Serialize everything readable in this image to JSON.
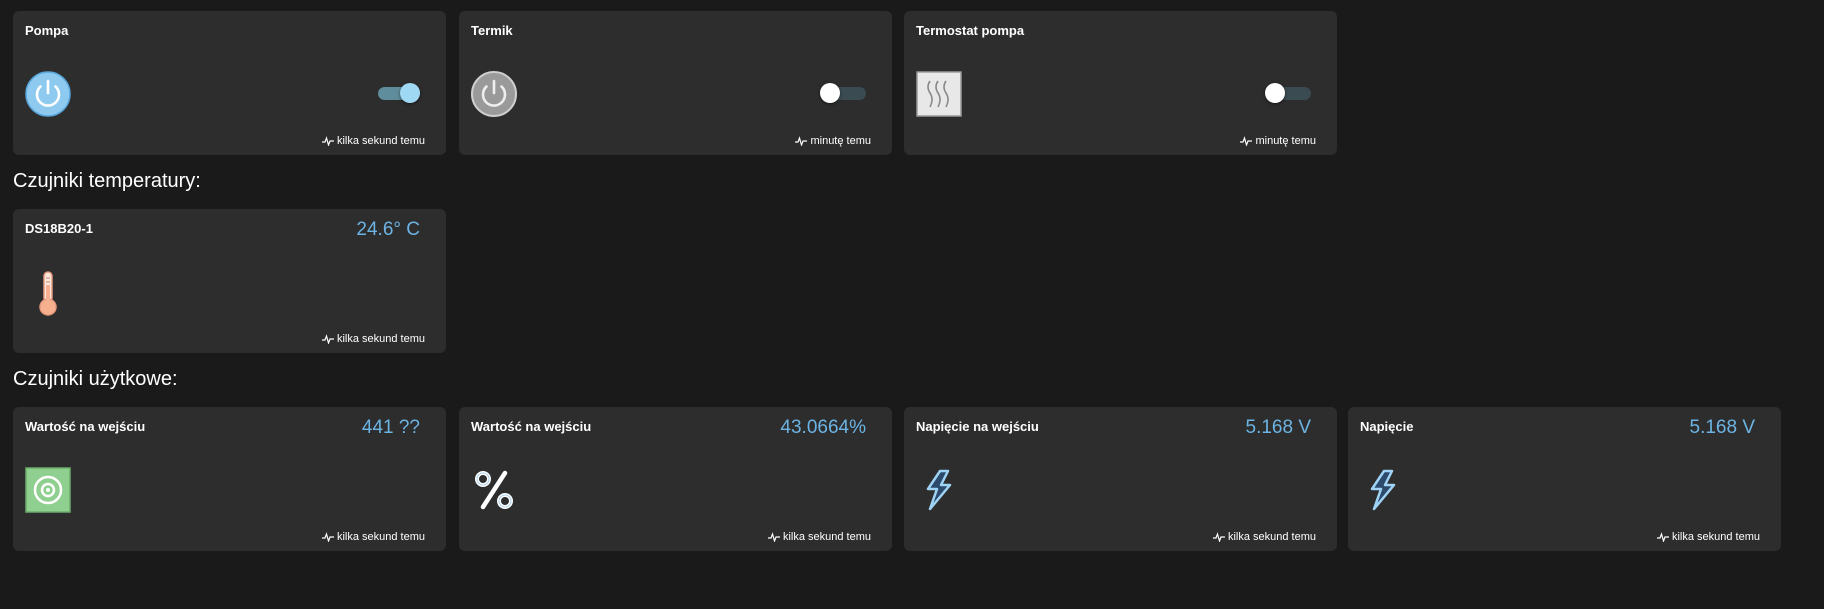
{
  "colors": {
    "background": "#1a1a1a",
    "card": "#2d2d2d",
    "value": "#6cb4e4"
  },
  "top_cards": [
    {
      "title": "Pompa",
      "icon": "power-icon-on",
      "switch_state": "on",
      "updated": "kilka sekund temu"
    },
    {
      "title": "Termik",
      "icon": "power-icon-off",
      "switch_state": "off",
      "updated": "minutę temu"
    },
    {
      "title": "Termostat pompa",
      "icon": "heater-icon",
      "switch_state": "off",
      "updated": "minutę temu"
    }
  ],
  "sections": {
    "temperature": "Czujniki temperatury:",
    "utility": "Czujniki użytkowe:"
  },
  "temperature_cards": [
    {
      "title": "DS18B20-1",
      "value": "24.6° C",
      "icon": "thermometer-icon",
      "updated": "kilka sekund temu"
    }
  ],
  "utility_cards": [
    {
      "title": "Wartość na wejściu",
      "value": "441 ??",
      "icon": "sensor-target-icon",
      "updated": "kilka sekund temu"
    },
    {
      "title": "Wartość na wejściu",
      "value": "43.0664%",
      "icon": "percent-icon",
      "updated": "kilka sekund temu"
    },
    {
      "title": "Napięcie na wejściu",
      "value": "5.168 V",
      "icon": "lightning-icon",
      "updated": "kilka sekund temu"
    },
    {
      "title": "Napięcie",
      "value": "5.168 V",
      "icon": "lightning-icon",
      "updated": "kilka sekund temu"
    }
  ]
}
